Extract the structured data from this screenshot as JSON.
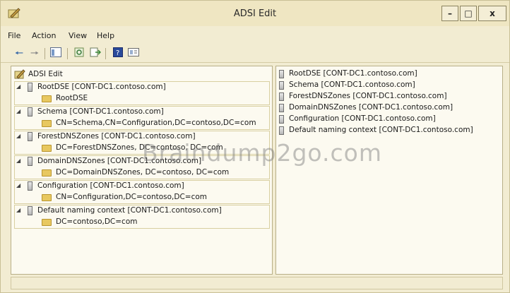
{
  "window": {
    "title": "ADSI Edit"
  },
  "menu": [
    "File",
    "Action",
    "View",
    "Help"
  ],
  "tree": {
    "root_label": "ADSI Edit",
    "nodes": [
      {
        "label": "RootDSE [CONT-DC1.contoso.com]",
        "child": "RootDSE"
      },
      {
        "label": "Schema [CONT-DC1.contoso.com]",
        "child": "CN=Schema,CN=Configuration,DC=contoso,DC=com"
      },
      {
        "label": "ForestDNSZones [CONT-DC1.contoso.com]",
        "child": "DC=ForestDNSZones, DC=contoso, DC=com"
      },
      {
        "label": "DomainDNSZones [CONT-DC1.contoso.com]",
        "child": "DC=DomainDNSZones, DC=contoso, DC=com"
      },
      {
        "label": "Configuration [CONT-DC1.contoso.com]",
        "child": "CN=Configuration,DC=contoso,DC=com"
      },
      {
        "label": "Default naming context [CONT-DC1.contoso.com]",
        "child": "DC=contoso,DC=com"
      }
    ]
  },
  "list": [
    "RootDSE [CONT-DC1.contoso.com]",
    "Schema [CONT-DC1.contoso.com]",
    "ForestDNSZones [CONT-DC1.contoso.com]",
    "DomainDNSZones [CONT-DC1.contoso.com]",
    "Configuration [CONT-DC1.contoso.com]",
    "Default naming context [CONT-DC1.contoso.com]"
  ],
  "watermark": "Braindump2go.com"
}
